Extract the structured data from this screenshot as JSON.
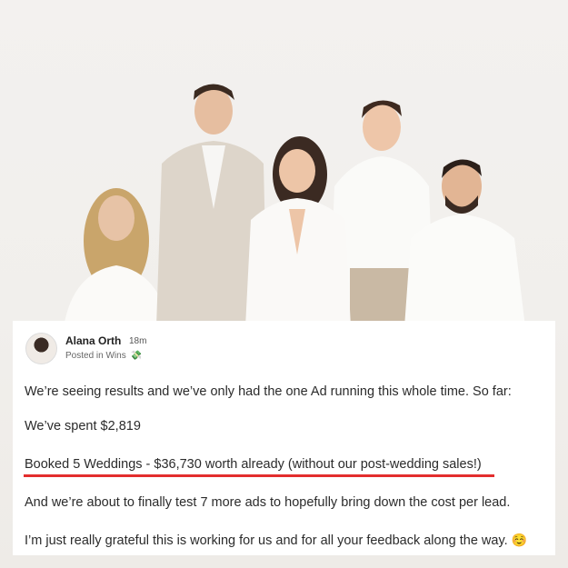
{
  "post": {
    "author": "Alana Orth",
    "time": "18m",
    "posted_in": "Posted in Wins",
    "category_icon": "money-with-wings-icon",
    "lines": [
      "We’re seeing results and we’ve only had the one Ad running this whole time. So far:",
      "We’ve spent $2,819",
      "Booked 5 Weddings - $36,730 worth already (without our post-wedding sales!)",
      "And we’re about to finally test 7 more ads to hopefully bring down the cost per lead.",
      "I’m just really grateful this is working for us and for all your feedback along the way."
    ],
    "emoji": "☺️"
  },
  "colors": {
    "highlight_underline": "#e32d2d",
    "background": "#f4f2f0"
  }
}
